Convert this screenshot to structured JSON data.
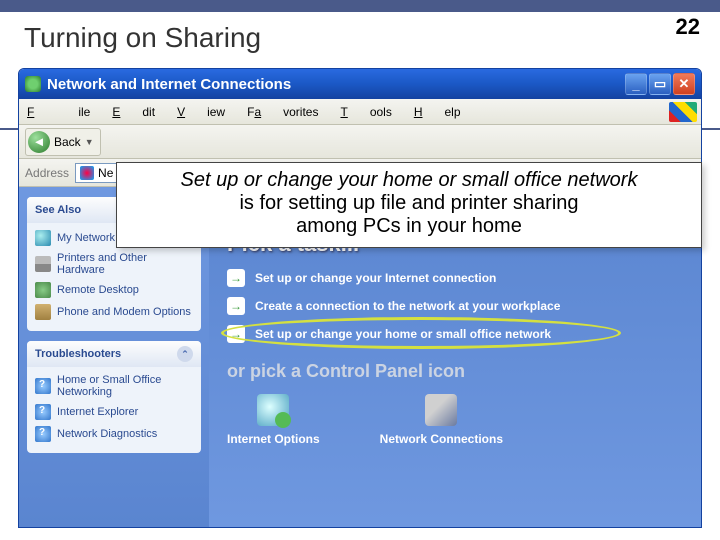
{
  "slide": {
    "title": "Turning on Sharing",
    "number": "22"
  },
  "window": {
    "title": "Network and Internet Connections"
  },
  "menu": {
    "file": "File",
    "edit": "Edit",
    "view": "View",
    "favorites": "Favorites",
    "tools": "Tools",
    "help": "Help"
  },
  "toolbar": {
    "back": "Back"
  },
  "addrbar": {
    "label": "Address",
    "value_prefix": "Ne"
  },
  "sidebar": {
    "see_also": {
      "title": "See Also",
      "items": [
        "My Network Places",
        "Printers and Other Hardware",
        "Remote Desktop",
        "Phone and Modem Options"
      ]
    },
    "troubleshooters": {
      "title": "Troubleshooters",
      "items": [
        "Home or Small Office Networking",
        "Internet Explorer",
        "Network Diagnostics"
      ]
    }
  },
  "main": {
    "pick_task": "Pick a task...",
    "tasks": [
      "Set up or change your Internet connection",
      "Create a connection to the network at your workplace",
      "Set up or change your home or small office network"
    ],
    "pick_icon": "or pick a Control Panel icon",
    "icons": {
      "inet": "Internet Options",
      "netconn": "Network Connections"
    }
  },
  "callout": {
    "line1": "Set up or change your home or small office network",
    "line2": "is for setting up file and printer sharing",
    "line3": "among PCs in your home"
  }
}
